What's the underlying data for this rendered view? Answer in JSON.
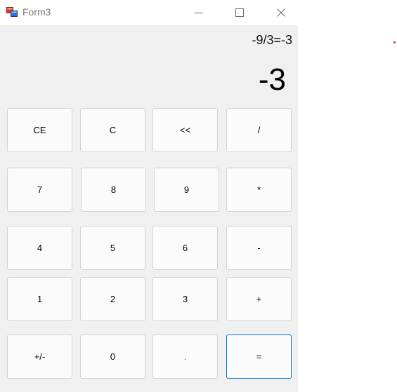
{
  "window": {
    "title": "Form3",
    "app_icon": "winforms-app-icon",
    "controls": {
      "minimize_icon": "minimize-icon",
      "maximize_icon": "maximize-icon",
      "close_icon": "close-icon"
    }
  },
  "display": {
    "expression": "-9/3=-3",
    "result": "-3"
  },
  "keys": {
    "ce": "CE",
    "c": "C",
    "backspace": "<<",
    "divide": "/",
    "seven": "7",
    "eight": "8",
    "nine": "9",
    "multiply": "*",
    "four": "4",
    "five": "5",
    "six": "6",
    "minus": "-",
    "one": "1",
    "two": "2",
    "three": "3",
    "plus": "+",
    "negate": "+/-",
    "zero": "0",
    "decimal": ".",
    "equals": "="
  },
  "colors": {
    "window_bg": "#f0f0f0",
    "button_bg": "#fbfbfb",
    "button_border": "#d2d2d2",
    "focus_border": "#0078d7",
    "dot": "#e0282e"
  }
}
